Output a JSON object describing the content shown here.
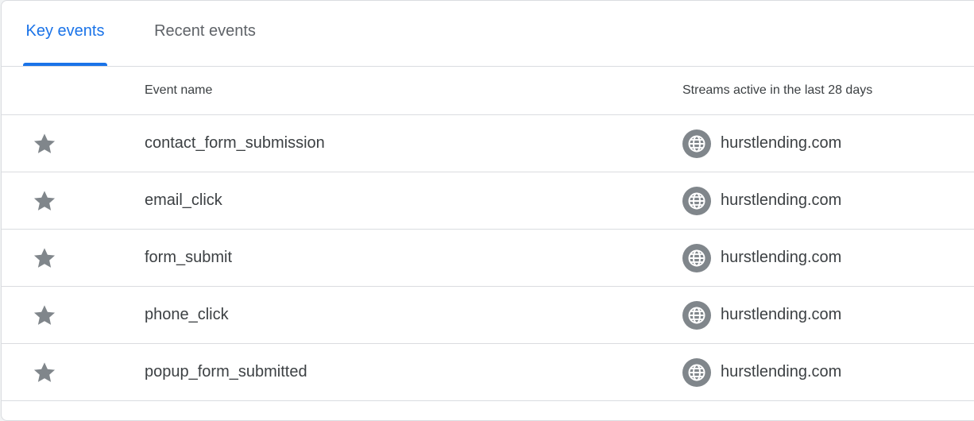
{
  "tabs": [
    {
      "label": "Key events",
      "active": true
    },
    {
      "label": "Recent events",
      "active": false
    }
  ],
  "table": {
    "columns": {
      "event_name": "Event name",
      "streams": "Streams active in the last 28 days"
    },
    "rows": [
      {
        "event_name": "contact_form_submission",
        "stream": "hurstlending.com",
        "starred": true
      },
      {
        "event_name": "email_click",
        "stream": "hurstlending.com",
        "starred": true
      },
      {
        "event_name": "form_submit",
        "stream": "hurstlending.com",
        "starred": true
      },
      {
        "event_name": "phone_click",
        "stream": "hurstlending.com",
        "starred": true
      },
      {
        "event_name": "popup_form_submitted",
        "stream": "hurstlending.com",
        "starred": true
      }
    ]
  },
  "icons": {
    "star": "star-icon",
    "stream": "globe-icon"
  },
  "colors": {
    "accent": "#1a73e8",
    "icon_gray": "#80868b",
    "text": "#3c4043",
    "muted_text": "#5f6368",
    "divider": "#dadce0"
  }
}
